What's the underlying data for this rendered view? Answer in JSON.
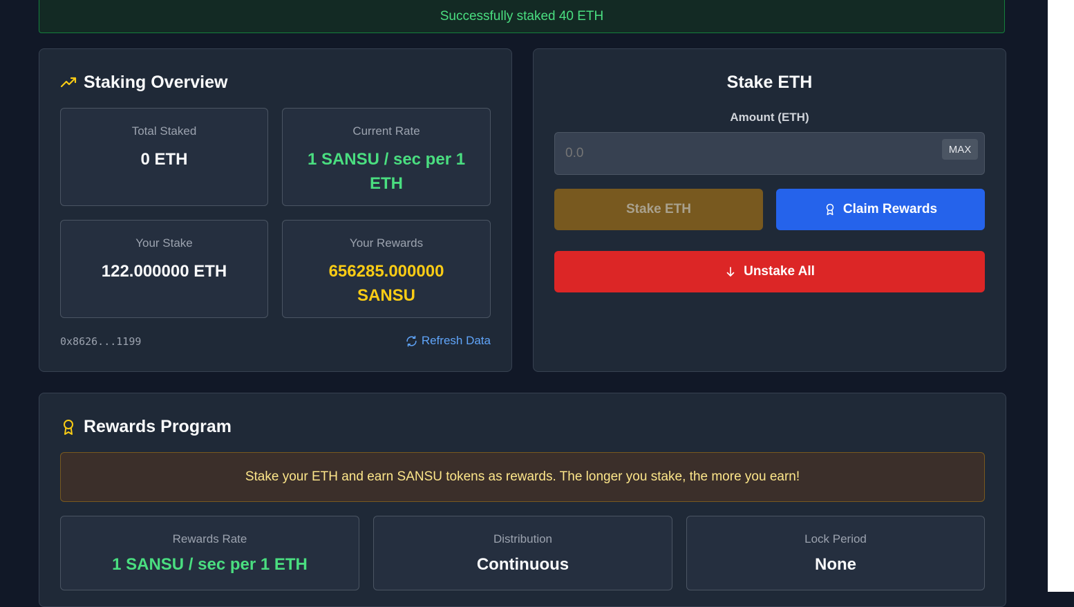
{
  "toast": {
    "message": "Successfully staked 40 ETH"
  },
  "overview": {
    "title": "Staking Overview",
    "total_staked": {
      "label": "Total Staked",
      "value": "0 ETH"
    },
    "current_rate": {
      "label": "Current Rate",
      "value": "1 SANSU / sec per 1 ETH"
    },
    "your_stake": {
      "label": "Your Stake",
      "value": "122.000000 ETH"
    },
    "your_rewards": {
      "label": "Your Rewards",
      "value": "656285.000000 SANSU"
    },
    "address": "0x8626...1199",
    "refresh_label": "Refresh Data"
  },
  "stake": {
    "title": "Stake ETH",
    "amount_label": "Amount (ETH)",
    "amount_placeholder": "0.0",
    "max_label": "MAX",
    "stake_button": "Stake ETH",
    "claim_button": "Claim Rewards",
    "unstake_button": "Unstake All"
  },
  "rewards": {
    "title": "Rewards Program",
    "notice": "Stake your ETH and earn SANSU tokens as rewards. The longer you stake, the more you earn!",
    "rate": {
      "label": "Rewards Rate",
      "value": "1 SANSU / sec per 1 ETH"
    },
    "distribution": {
      "label": "Distribution",
      "value": "Continuous"
    },
    "lock": {
      "label": "Lock Period",
      "value": "None"
    }
  },
  "colors": {
    "background": "#111827",
    "card": "#1f2937",
    "success": "#4ade80",
    "accent_yellow": "#facc15",
    "stake_button": "#78591f",
    "claim_button": "#2563eb",
    "unstake_button": "#dc2626"
  },
  "icons": {
    "overview": "trending-up-icon",
    "refresh": "refresh-icon",
    "claim": "award-icon",
    "unstake": "arrow-down-icon",
    "rewards": "award-icon"
  }
}
